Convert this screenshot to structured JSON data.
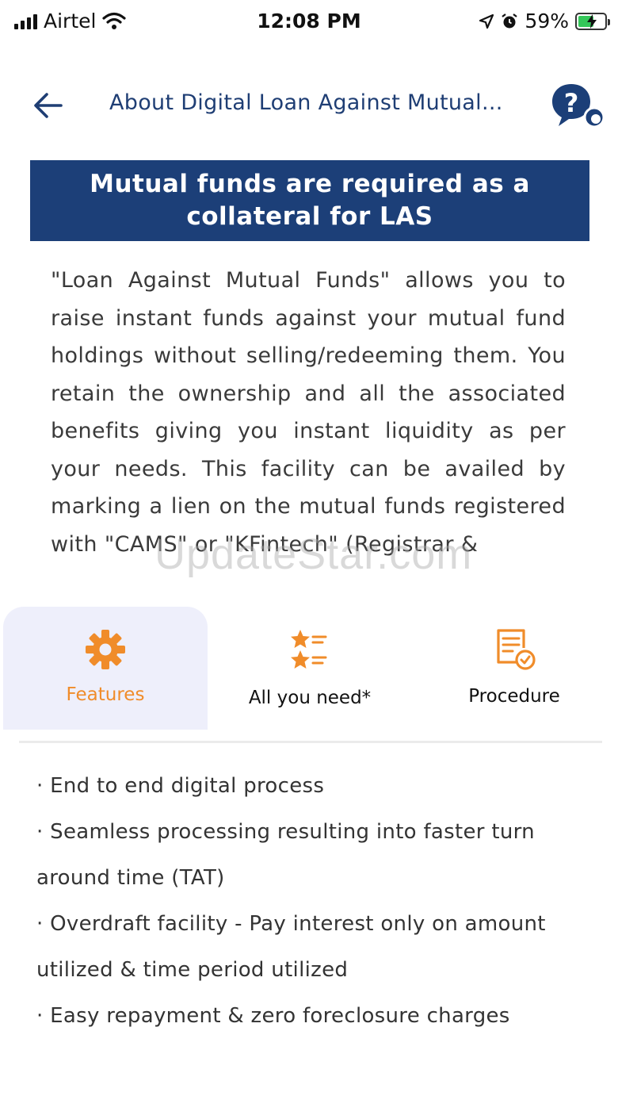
{
  "status_bar": {
    "carrier": "Airtel",
    "time": "12:08 PM",
    "battery_percent": "59%",
    "battery_level": 0.59
  },
  "header": {
    "title": "About Digital Loan Against Mutual..."
  },
  "banner": {
    "line1": "Mutual funds are required as a",
    "line2": "collateral for LAS"
  },
  "description": "\"Loan Against Mutual Funds\" allows you to raise instant funds against your mutual fund holdings without selling/redeeming them. You retain the ownership and all the associated benefits giving you instant liquidity as per your needs. This facility can be availed by marking a lien on the mutual funds registered with \"CAMS\" or \"KFintech\" (Registrar &",
  "watermark": "UpdateStar.com",
  "tabs": [
    {
      "label": "Features",
      "icon": "gear-icon",
      "selected": true
    },
    {
      "label": "All you need*",
      "icon": "star-list-icon",
      "selected": false
    },
    {
      "label": "Procedure",
      "icon": "document-check-icon",
      "selected": false
    }
  ],
  "features": [
    "End to end digital process",
    "Seamless processing resulting into faster turn around time (TAT)",
    "Overdraft facility - Pay interest only on amount utilized & time period utilized",
    "Easy repayment & zero foreclosure charges"
  ],
  "colors": {
    "brand_blue": "#1c3f78",
    "accent_orange": "#f08c2a",
    "selected_tab_bg": "#eeeffb"
  }
}
